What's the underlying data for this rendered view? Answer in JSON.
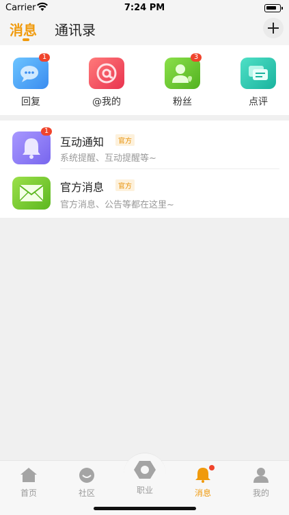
{
  "status_bar": {
    "carrier": "Carrier",
    "time": "7:24 PM"
  },
  "header": {
    "tabs": [
      {
        "label": "消息",
        "active": true
      },
      {
        "label": "通讯录",
        "active": false
      }
    ]
  },
  "quick_actions": [
    {
      "label": "回复",
      "icon": "chat-bubble-icon",
      "badge": "1",
      "color": "#4aa6f2"
    },
    {
      "label": "@我的",
      "icon": "at-sign-icon",
      "badge": "",
      "color": "#f25565"
    },
    {
      "label": "粉丝",
      "icon": "follower-icon",
      "badge": "3",
      "color": "#72c93a"
    },
    {
      "label": "点评",
      "icon": "comment-icon",
      "badge": "",
      "color": "#2fc7b5"
    }
  ],
  "messages": [
    {
      "title": "互动通知",
      "tag": "官方",
      "subtitle": "系统提醒、互动提醒等~",
      "badge": "1",
      "icon": "bell-icon",
      "color": "#8b7cf3"
    },
    {
      "title": "官方消息",
      "tag": "官方",
      "subtitle": "官方消息、公告等都在这里~",
      "badge": "",
      "icon": "envelope-icon",
      "color": "#7cc936"
    }
  ],
  "tabbar": [
    {
      "label": "首页",
      "icon": "home-icon",
      "active": false
    },
    {
      "label": "社区",
      "icon": "community-icon",
      "active": false
    },
    {
      "label": "职业",
      "icon": "career-icon",
      "active": false
    },
    {
      "label": "消息",
      "icon": "bell-icon",
      "active": true
    },
    {
      "label": "我的",
      "icon": "profile-icon",
      "active": false
    }
  ],
  "colors": {
    "accent": "#f09a0c",
    "badge": "#f0442c"
  }
}
